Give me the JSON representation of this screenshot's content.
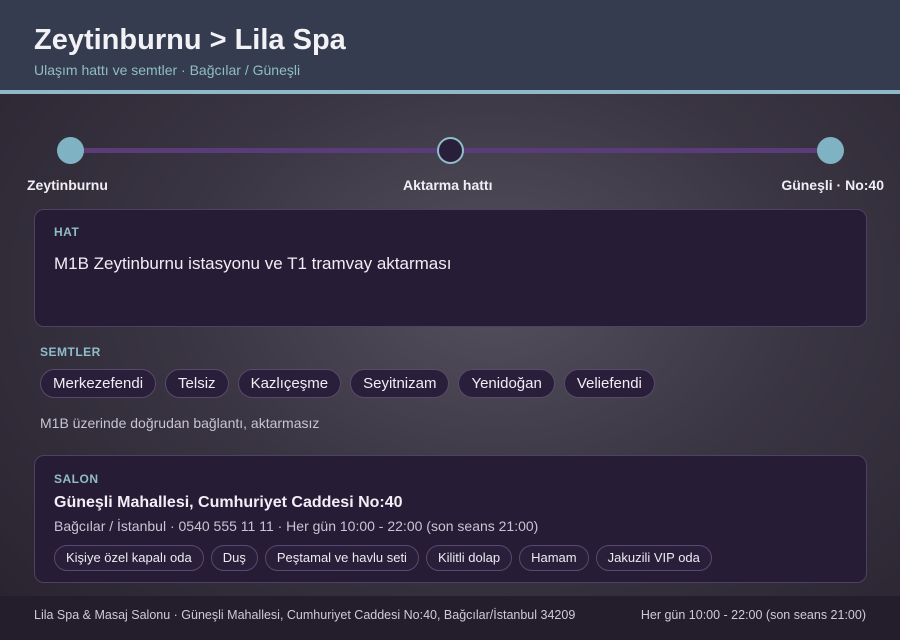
{
  "header": {
    "title": "Zeytinburnu > Lila Spa",
    "subtitle": "Ulaşım hattı ve semtler · Bağcılar / Güneşli"
  },
  "route": {
    "start": "Zeytinburnu",
    "middle": "Aktarma hattı",
    "end": "Güneşli · No:40",
    "colors": {
      "line": "#5a3d78",
      "stop": "#7fb3c3"
    }
  },
  "hat": {
    "title": "HAT",
    "text": "M1B Zeytinburnu istasyonu ve T1 tramvay aktarması"
  },
  "semtler": {
    "title": "SEMTLER",
    "items": [
      "Merkezefendi",
      "Telsiz",
      "Kazlıçeşme",
      "Seyitnizam",
      "Yenidoğan",
      "Veliefendi"
    ],
    "note": "M1B üzerinde doğrudan bağlantı, aktarmasız"
  },
  "salon": {
    "title": "SALON",
    "address": "Güneşli Mahallesi, Cumhuriyet Caddesi No:40",
    "meta": "Bağcılar / İstanbul · 0540 555 11 11 · Her gün 10:00 - 22:00 (son seans 21:00)",
    "features": [
      "Kişiye özel kapalı oda",
      "Duş",
      "Peştamal ve havlu seti",
      "Kilitli dolap",
      "Hamam",
      "Jakuzili VIP oda"
    ]
  },
  "footer": {
    "left": "Lila Spa & Masaj Salonu · Güneşli Mahallesi, Cumhuriyet Caddesi No:40, Bağcılar/İstanbul 34209",
    "right": "Her gün 10:00 - 22:00 (son seans 21:00)"
  },
  "colors": {
    "accent": "#8fbdc9",
    "card_bg": "#271c36",
    "header_bg": "#363c4f"
  }
}
